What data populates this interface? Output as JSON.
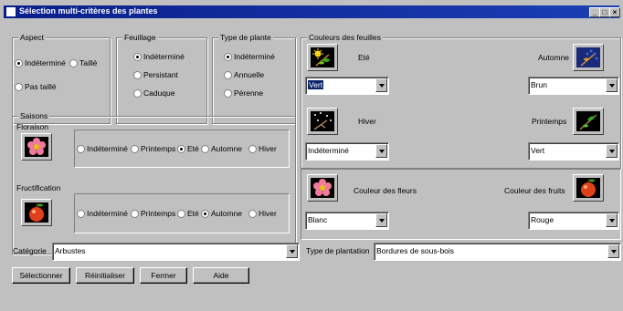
{
  "window": {
    "title": "Sélection multi-critères des plantes",
    "min": "_",
    "max": "□",
    "close": "×"
  },
  "aspect": {
    "legend": "Aspect",
    "opts": [
      "Indéterminé",
      "Taillé",
      "Pas taillé"
    ],
    "selected": "Indéterminé"
  },
  "feuillage": {
    "legend": "Feuillage",
    "opts": [
      "Indéterminé",
      "Persistant",
      "Caduque"
    ],
    "selected": "Indéterminé"
  },
  "type_plante": {
    "legend": "Type de plante",
    "opts": [
      "Indéterminé",
      "Annuelle",
      "Pérenne"
    ],
    "selected": "Indéterminé"
  },
  "saisons": {
    "legend": "Saisons",
    "floraison": {
      "label": "Floraison",
      "opts": [
        "Indéterminé",
        "Printemps",
        "Eté",
        "Automne",
        "Hiver"
      ],
      "selected": "Eté"
    },
    "fructification": {
      "label": "Fructification",
      "opts": [
        "Indéterminé",
        "Printemps",
        "Eté",
        "Automne",
        "Hiver"
      ],
      "selected": "Automne"
    }
  },
  "couleurs": {
    "legend": "Couleurs des feuilles",
    "ete": {
      "label": "Eté",
      "value": "Vert"
    },
    "automne": {
      "label": "Automne",
      "value": "Brun"
    },
    "hiver": {
      "label": "Hiver",
      "value": "Indéterminé"
    },
    "printemps": {
      "label": "Printemps",
      "value": "Vert"
    }
  },
  "fleurs": {
    "label": "Couleur des fleurs",
    "value": "Blanc"
  },
  "fruits": {
    "label": "Couleur des fruits",
    "value": "Rouge"
  },
  "categorie": {
    "label": "Catégorie",
    "value": "Arbustes"
  },
  "type_plantation": {
    "label": "Type de plantation",
    "value": "Bordures de sous-bois"
  },
  "buttons": {
    "select": "Sélectionner",
    "reset": "Réinitialiser",
    "close": "Fermer",
    "help": "Aide"
  }
}
